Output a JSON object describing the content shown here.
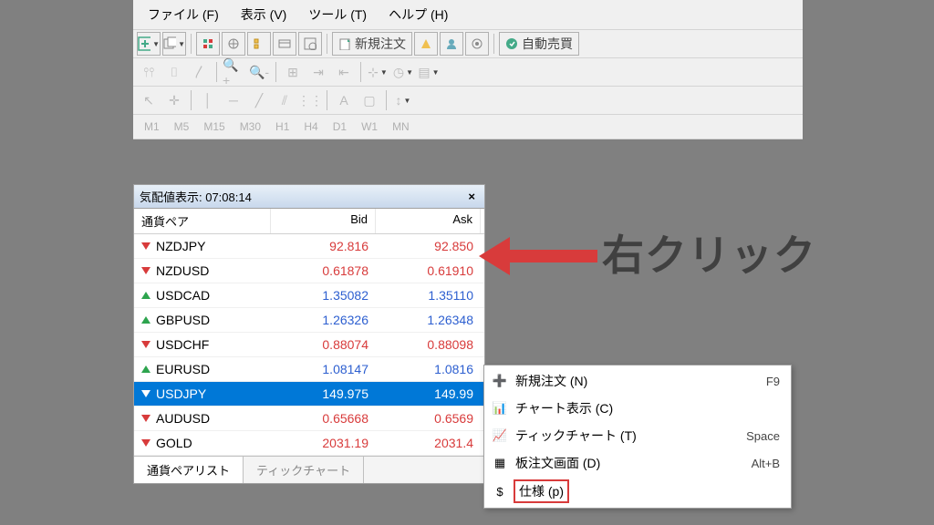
{
  "menu": {
    "file": "ファイル (F)",
    "view": "表示 (V)",
    "tools": "ツール (T)",
    "help": "ヘルプ (H)"
  },
  "toolbar": {
    "new_order": "新規注文",
    "auto_trade": "自動売買"
  },
  "timeframes": [
    "M1",
    "M5",
    "M15",
    "M30",
    "H1",
    "H4",
    "D1",
    "W1",
    "MN"
  ],
  "market_watch": {
    "title": "気配値表示: 07:08:14",
    "header_symbol": "通貨ペア",
    "header_bid": "Bid",
    "header_ask": "Ask",
    "rows": [
      {
        "symbol": "NZDJPY",
        "bid": "92.816",
        "ask": "92.850",
        "dir": "down",
        "cls": "price-down"
      },
      {
        "symbol": "NZDUSD",
        "bid": "0.61878",
        "ask": "0.61910",
        "dir": "down",
        "cls": "price-down"
      },
      {
        "symbol": "USDCAD",
        "bid": "1.35082",
        "ask": "1.35110",
        "dir": "up",
        "cls": "price-up"
      },
      {
        "symbol": "GBPUSD",
        "bid": "1.26326",
        "ask": "1.26348",
        "dir": "up",
        "cls": "price-up"
      },
      {
        "symbol": "USDCHF",
        "bid": "0.88074",
        "ask": "0.88098",
        "dir": "down",
        "cls": "price-down"
      },
      {
        "symbol": "EURUSD",
        "bid": "1.08147",
        "ask": "1.0816",
        "dir": "up",
        "cls": "price-up"
      },
      {
        "symbol": "USDJPY",
        "bid": "149.975",
        "ask": "149.99",
        "dir": "down",
        "cls": "price-down",
        "selected": true
      },
      {
        "symbol": "AUDUSD",
        "bid": "0.65668",
        "ask": "0.6569",
        "dir": "down",
        "cls": "price-down"
      },
      {
        "symbol": "GOLD",
        "bid": "2031.19",
        "ask": "2031.4",
        "dir": "down",
        "cls": "price-down"
      }
    ],
    "tabs": {
      "list": "通貨ペアリスト",
      "tick": "ティックチャート"
    }
  },
  "context_menu": {
    "items": [
      {
        "label": "新規注文 (N)",
        "shortcut": "F9",
        "icon": "➕"
      },
      {
        "label": "チャート表示 (C)",
        "shortcut": "",
        "icon": "📊"
      },
      {
        "label": "ティックチャート (T)",
        "shortcut": "Space",
        "icon": "📈"
      },
      {
        "label": "板注文画面 (D)",
        "shortcut": "Alt+B",
        "icon": "▦"
      },
      {
        "label": "仕様 (p)",
        "shortcut": "",
        "icon": "$",
        "highlighted": true
      }
    ]
  },
  "annotation": "右クリック"
}
